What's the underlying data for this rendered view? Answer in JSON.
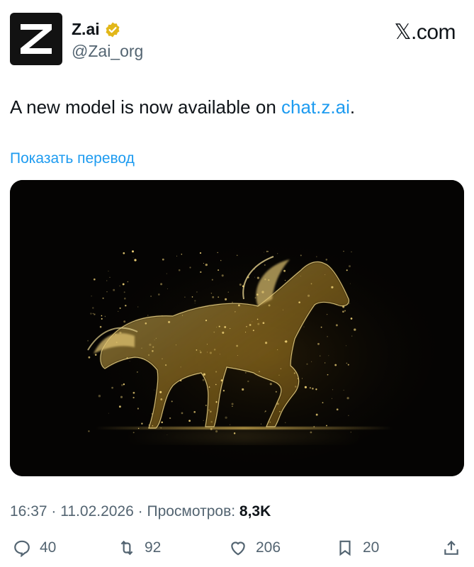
{
  "tweet": {
    "display_name": "Z.ai",
    "handle": "@Zai_org",
    "brand": "𝕏.com",
    "text_before": "A new model is now available on ",
    "link": "chat.z.ai",
    "text_after": ".",
    "translate_label": "Показать перевод",
    "time": "16:37",
    "date": "11.02.2026",
    "views_label": "Просмотров:",
    "views_count": "8,3K",
    "separator": "·"
  },
  "actions": {
    "replies": "40",
    "reposts": "92",
    "likes": "206",
    "bookmarks": "20"
  },
  "icons": {
    "avatar": "z-logo-icon",
    "verified": "verified-badge-icon",
    "reply": "reply-icon",
    "repost": "repost-icon",
    "like": "heart-icon",
    "bookmark": "bookmark-icon",
    "share": "share-icon"
  },
  "colors": {
    "link": "#1d9bf0",
    "muted": "#536471",
    "text": "#0f1419",
    "verified": "#e2b719",
    "media_gold": "#e9c25a"
  }
}
